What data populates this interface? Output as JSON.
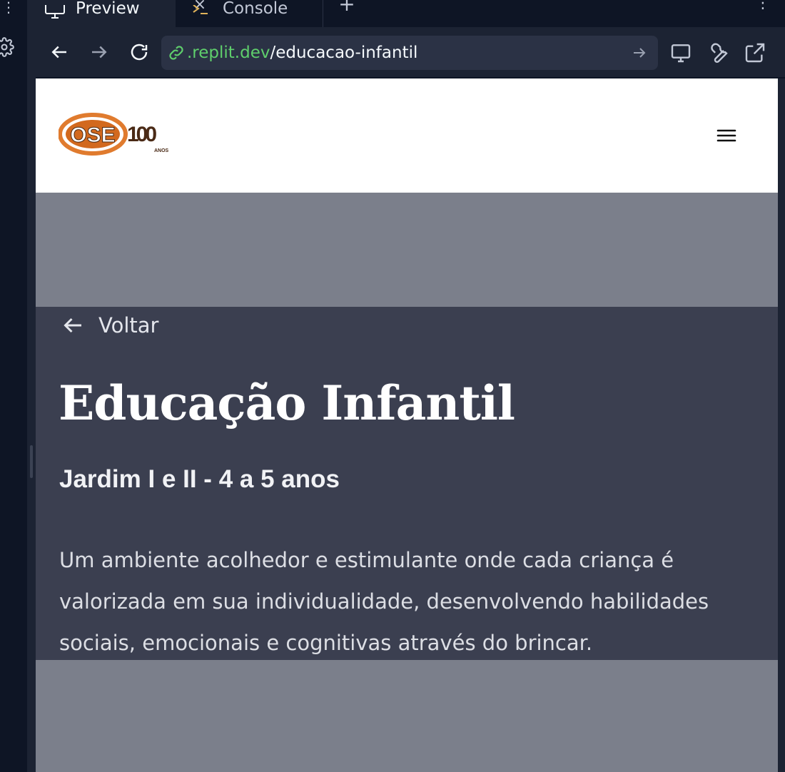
{
  "workspace": {
    "dots_glyph": "⋮"
  },
  "tabs": [
    {
      "label": "Preview",
      "icon": "monitor-icon",
      "active": true
    },
    {
      "label": "Console",
      "icon": "terminal-icon",
      "active": false
    }
  ],
  "tab_close_glyph": "×",
  "tab_add_glyph": "+",
  "tab_more_glyph": "⋮",
  "toolbar": {
    "url_domain": ".replit.dev",
    "url_path": "/educacao-infantil",
    "tools": [
      "devices-icon",
      "wrench-icon",
      "open-external-icon"
    ]
  },
  "site": {
    "logo_text": "OSE",
    "logo_centenary": "100",
    "logo_anos": "ANOS",
    "back_label": "Voltar",
    "title": "Educação Infantil",
    "subtitle": "Jardim I e II - 4 a 5 anos",
    "description": "Um ambiente acolhedor e estimulante onde cada criança é valorizada em sua individualidade, desenvolvendo habilidades sociais, emocionais e cognitivas através do brincar."
  },
  "colors": {
    "ide_bg": "#0e1525",
    "panel_bg": "#1c2333",
    "url_domain": "#5fcf6c",
    "content_bg": "#3b3f50",
    "overlay": "#7b7f8b",
    "logo_orange": "#e07b2e",
    "logo_dark": "#4a2a16"
  }
}
